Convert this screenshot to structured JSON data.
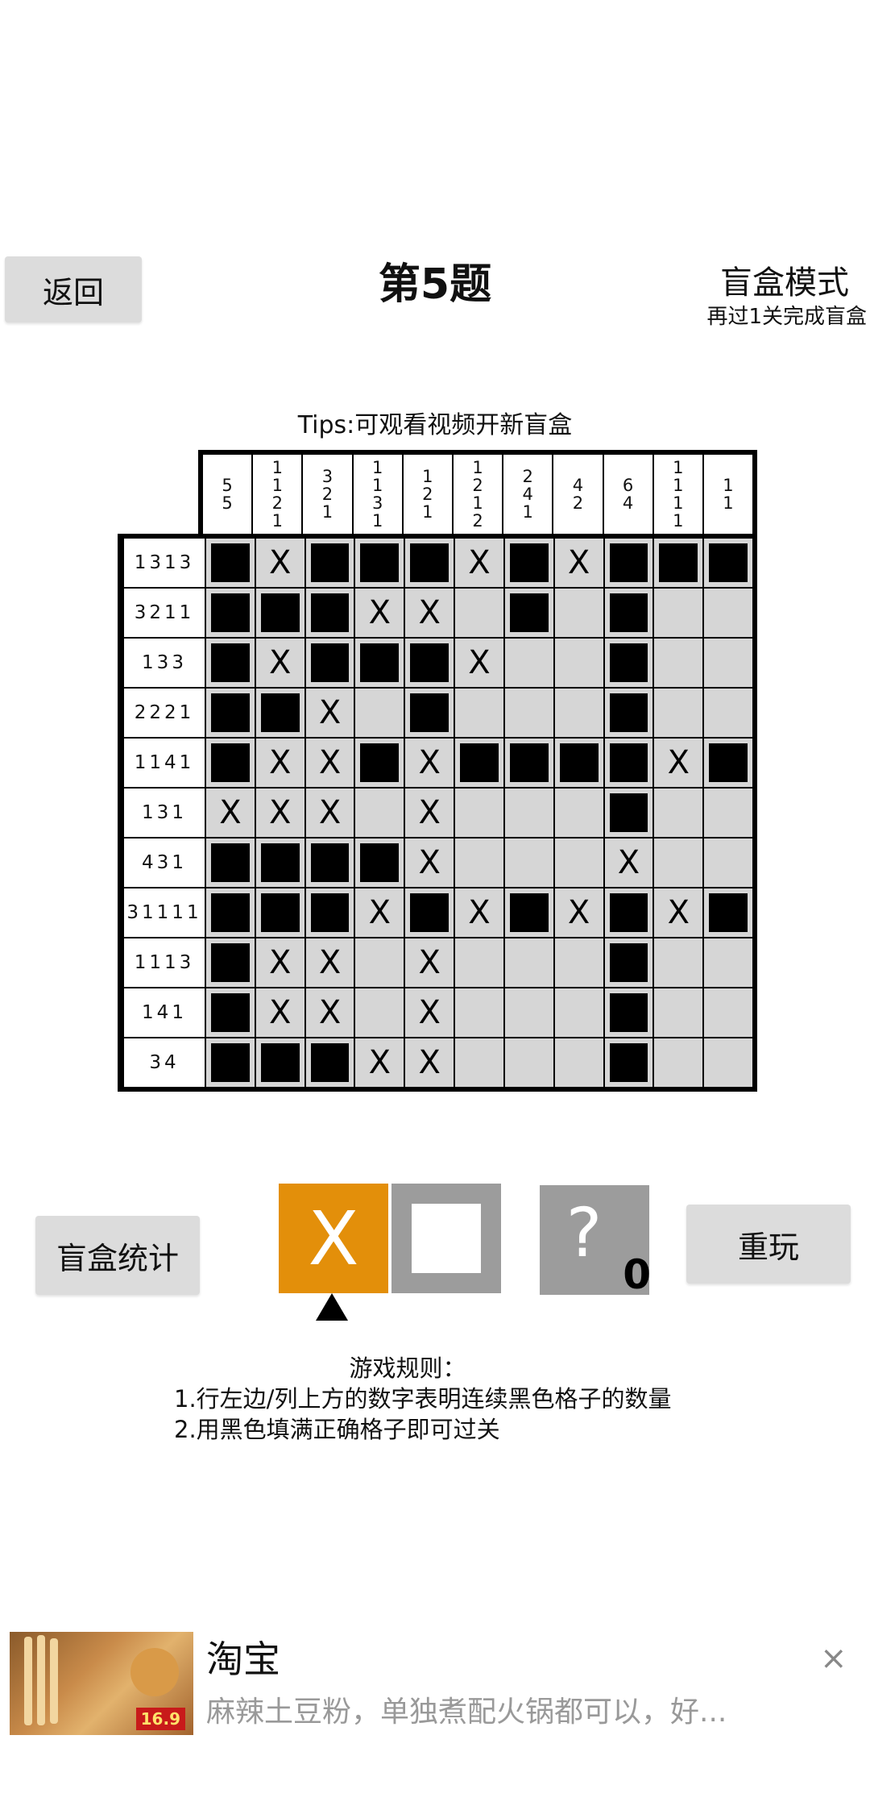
{
  "header": {
    "back_label": "返回",
    "title": "第5题",
    "mode_label": "盲盒模式",
    "mode_subtitle": "再过1关完成盲盒"
  },
  "tips": "Tips:可观看视频开新盲盒",
  "puzzle": {
    "col_clues": [
      [
        "5",
        "5"
      ],
      [
        "1",
        "1",
        "2",
        "1"
      ],
      [
        "3",
        "2",
        "1"
      ],
      [
        "1",
        "1",
        "3",
        "1"
      ],
      [
        "1",
        "2",
        "1"
      ],
      [
        "1",
        "2",
        "1",
        "2"
      ],
      [
        "2",
        "4",
        "1"
      ],
      [
        "4",
        "2"
      ],
      [
        "6",
        "4"
      ],
      [
        "1",
        "1",
        "1",
        "1"
      ],
      [
        "1",
        "1"
      ]
    ],
    "row_clues": [
      "1313",
      "3211",
      "133",
      "2221",
      "1141",
      "131",
      "431",
      "31111",
      "1113",
      "141",
      "34"
    ],
    "cells": [
      "FXFFFXFXFFF",
      "FFFXX.F.F..",
      "FXFFFX..F..",
      "FFX.F...F..",
      "FXXFXFFFFXF",
      "XXX.X...F..",
      "FFFFX...X..",
      "FFFXFXFXFXF",
      "FXX.X...F..",
      "FXX.X...F..",
      "FFFXX...F.."
    ]
  },
  "controls": {
    "stats_label": "盲盒统计",
    "tool_x_label": "X",
    "hint_symbol": "?",
    "hint_count": "0",
    "replay_label": "重玩"
  },
  "rules": {
    "title": "游戏规则：",
    "line1": "1.行左边/列上方的数字表明连续黑色格子的数量",
    "line2": "2.用黑色填满正确格子即可过关"
  },
  "ad": {
    "title": "淘宝",
    "description": "麻辣土豆粉，单独煮配火锅都可以，好...",
    "price": "16.9",
    "close_icon": "×"
  },
  "colors": {
    "accent": "#e38f0a",
    "cell_empty": "#d6d6d6",
    "button_gray": "#dcdcdc",
    "tool_gray": "#9c9c9c"
  }
}
